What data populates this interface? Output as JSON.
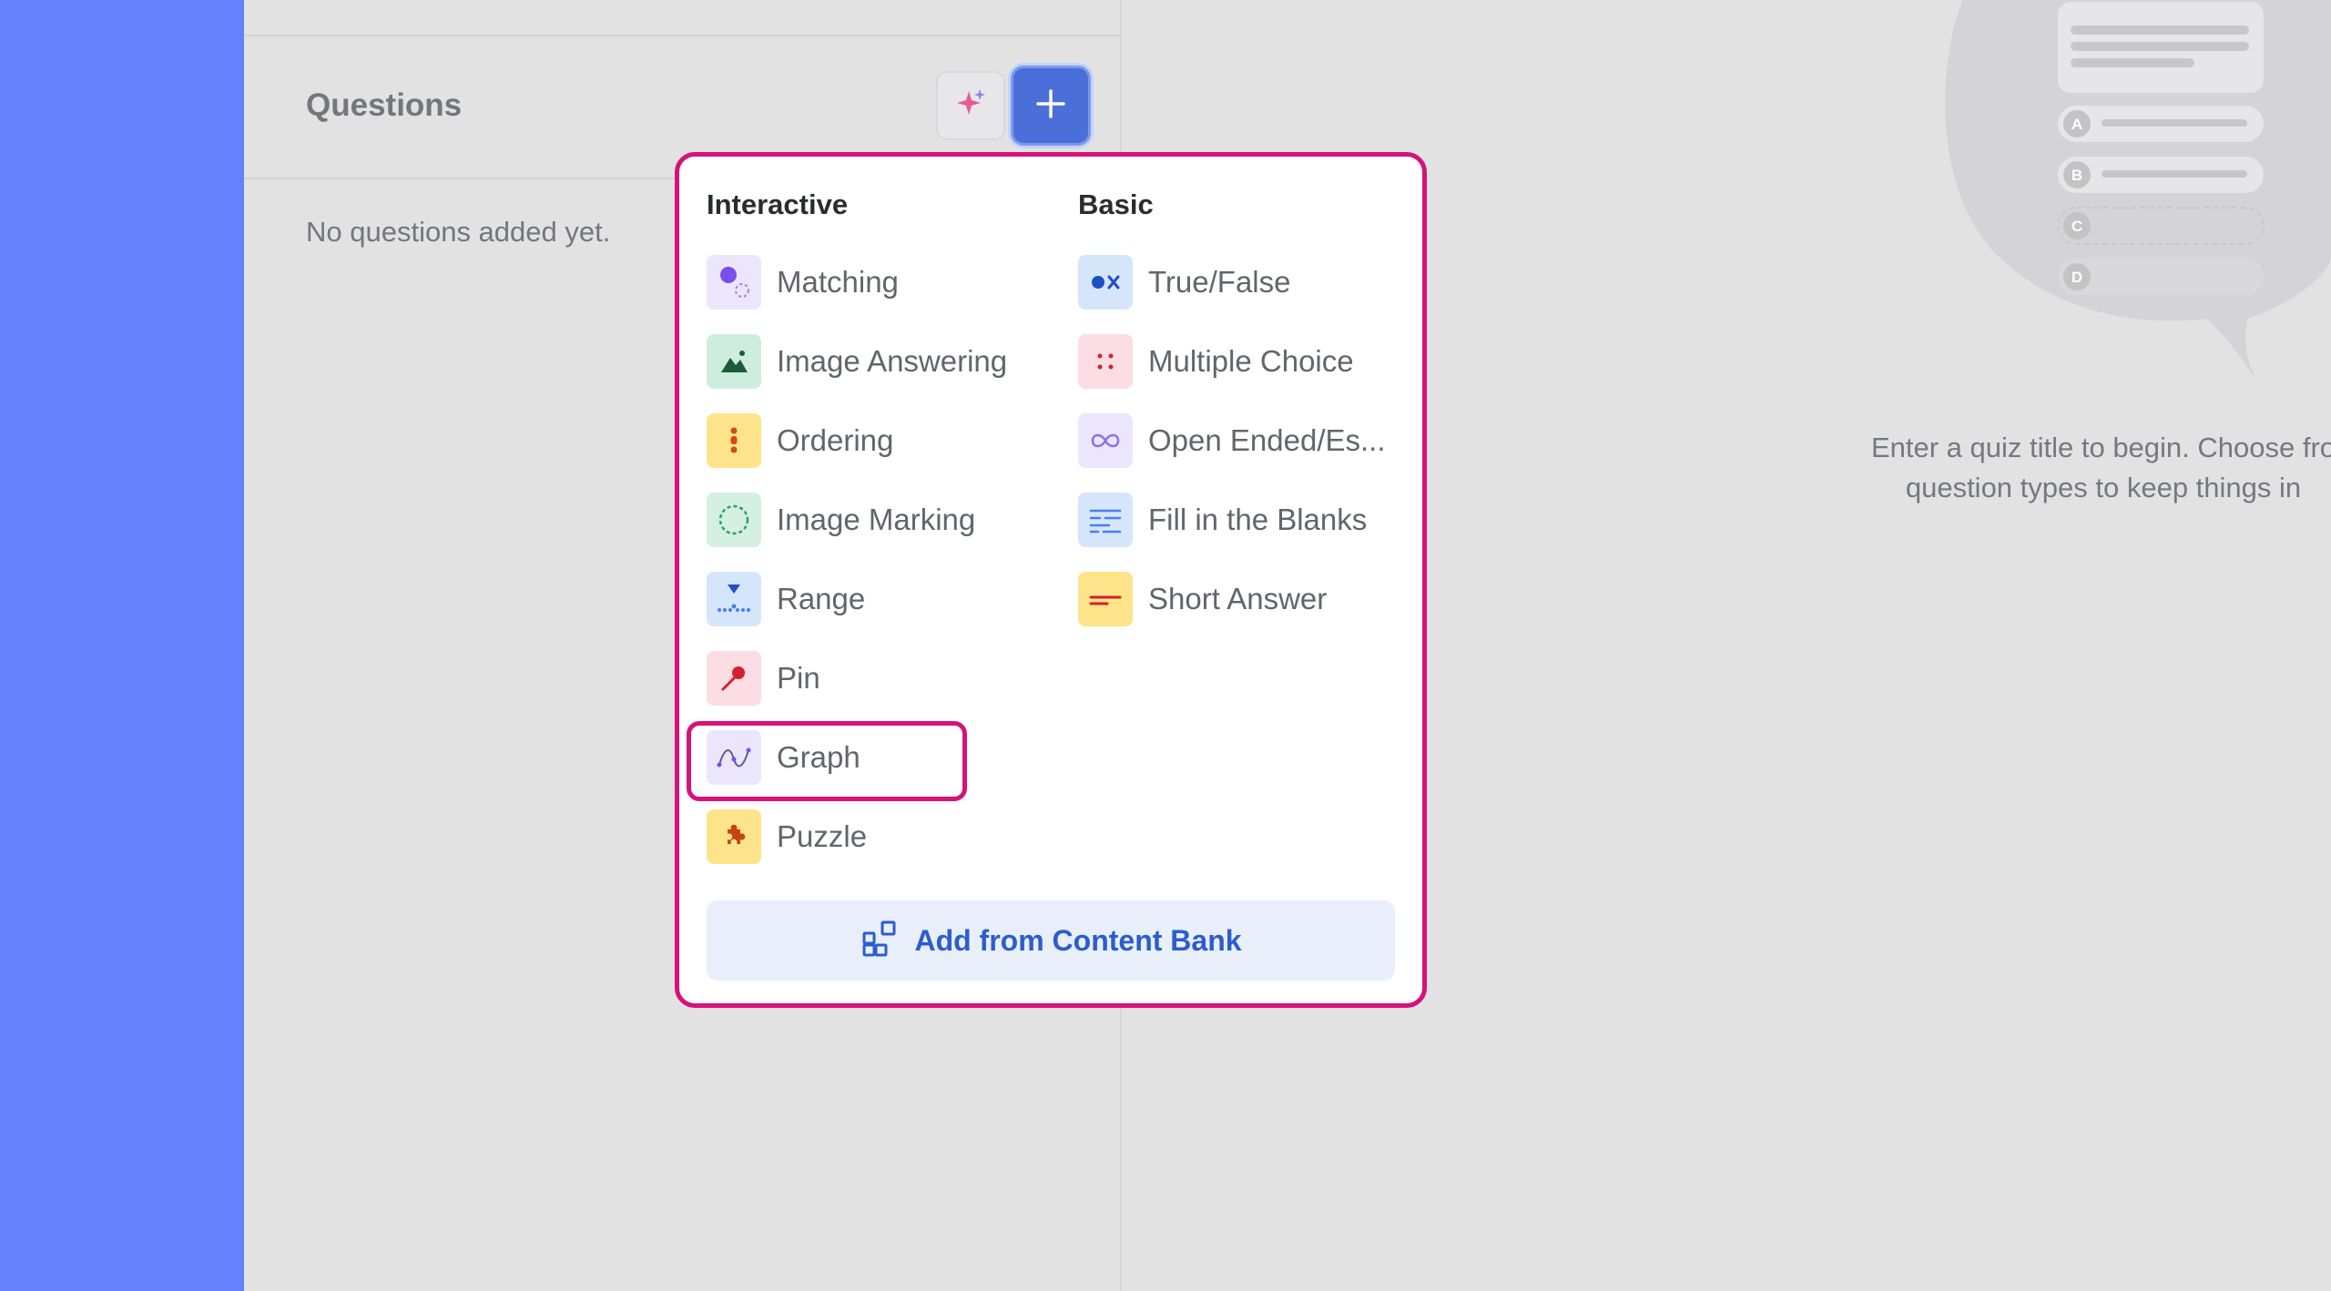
{
  "panel": {
    "title": "Questions",
    "empty_message": "No questions added yet."
  },
  "toolbar": {
    "ai_icon": "sparkles-icon",
    "add_icon": "plus-icon"
  },
  "menu": {
    "interactive_heading": "Interactive",
    "basic_heading": "Basic",
    "interactive": [
      {
        "label": "Matching",
        "icon": "matching-icon",
        "bg": "#ece6fd"
      },
      {
        "label": "Image Answering",
        "icon": "image-answering-icon",
        "bg": "#cdeedd"
      },
      {
        "label": "Ordering",
        "icon": "ordering-icon",
        "bg": "#fde48a"
      },
      {
        "label": "Image Marking",
        "icon": "image-marking-icon",
        "bg": "#d3f0e0"
      },
      {
        "label": "Range",
        "icon": "range-icon",
        "bg": "#d5e6fb"
      },
      {
        "label": "Pin",
        "icon": "pin-icon",
        "bg": "#fcdde3"
      },
      {
        "label": "Graph",
        "icon": "graph-icon",
        "bg": "#ece6fd"
      },
      {
        "label": "Puzzle",
        "icon": "puzzle-icon",
        "bg": "#fde48a"
      }
    ],
    "basic": [
      {
        "label": "True/False",
        "icon": "true-false-icon",
        "bg": "#d5e6fb"
      },
      {
        "label": "Multiple Choice",
        "icon": "multiple-choice-icon",
        "bg": "#fcdde3"
      },
      {
        "label": "Open Ended/Es...",
        "icon": "open-ended-icon",
        "bg": "#ece6fd"
      },
      {
        "label": "Fill in the Blanks",
        "icon": "fill-blanks-icon",
        "bg": "#d5e6fb"
      },
      {
        "label": "Short Answer",
        "icon": "short-answer-icon",
        "bg": "#fde48a"
      }
    ],
    "content_bank_label": "Add from Content Bank",
    "content_bank_icon": "content-bank-icon"
  },
  "preview": {
    "hint": "Enter a quiz title to begin. Choose fro\n question types to keep things in",
    "options": [
      "A",
      "B",
      "C",
      "D"
    ]
  },
  "colors": {
    "sidebar": "#6582fc",
    "accent": "#4a6fd9",
    "highlight": "#d6127a"
  }
}
